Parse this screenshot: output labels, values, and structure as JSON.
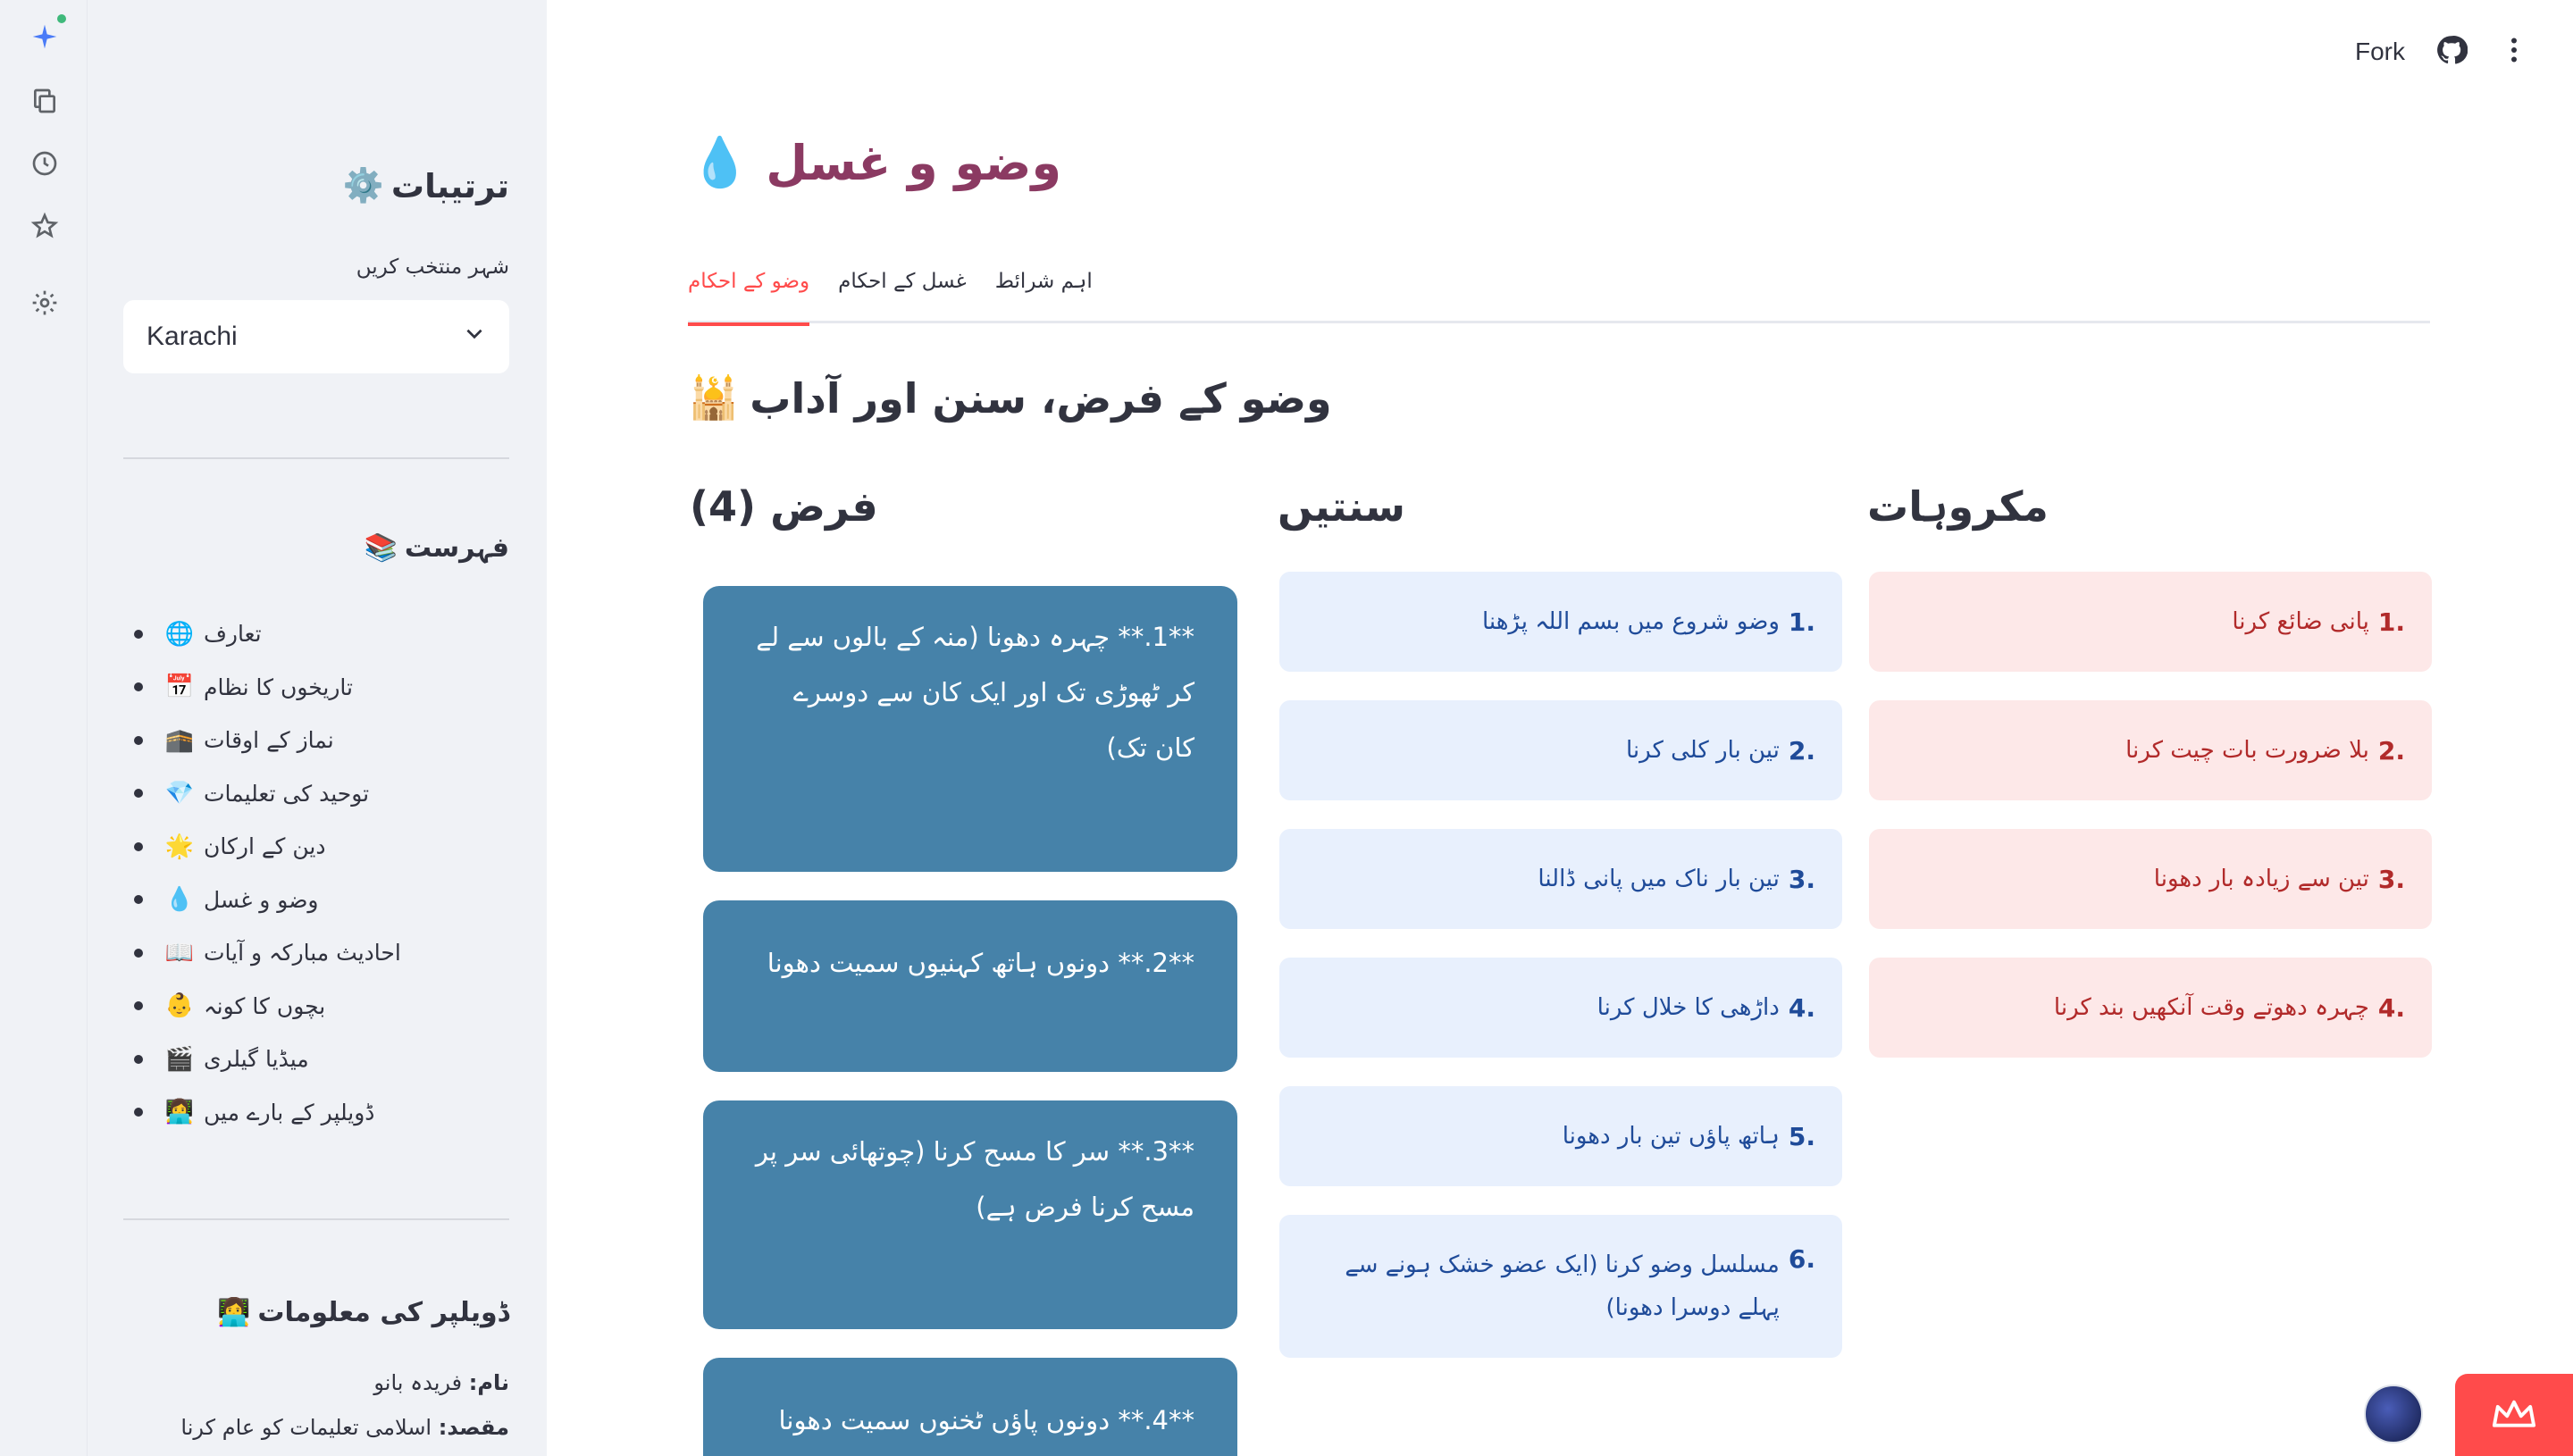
{
  "header": {
    "fork_label": "Fork"
  },
  "sidebar": {
    "settings_title": "ترتیبات",
    "settings_icon": "⚙️",
    "city_label": "شہر منتخب کریں",
    "city_value": "Karachi",
    "toc_title": "فہرست",
    "toc_icon": "📚",
    "toc": [
      {
        "label": "تعارف",
        "emoji": "🌐"
      },
      {
        "label": "تاریخوں کا نظام",
        "emoji": "📅"
      },
      {
        "label": "نماز کے اوقات",
        "emoji": "🕋"
      },
      {
        "label": "توحید کی تعلیمات",
        "emoji": "💎"
      },
      {
        "label": "دین کے ارکان",
        "emoji": "🌟"
      },
      {
        "label": "وضو و غسل",
        "emoji": "💧"
      },
      {
        "label": "احادیث مبارکہ و آیات",
        "emoji": "📖"
      },
      {
        "label": "بچوں کا کونہ",
        "emoji": "👶"
      },
      {
        "label": "میڈیا گیلری",
        "emoji": "🎬"
      },
      {
        "label": "ڈویلپر کے بارے میں",
        "emoji": "👩‍💻"
      }
    ],
    "dev_title": "ڈویلپر کی معلومات",
    "dev_icon": "👩‍💻",
    "dev_name_key": "نام:",
    "dev_name_value": "فریدہ بانو",
    "dev_purpose_key": "مقصد:",
    "dev_purpose_value": "اسلامی تعلیمات کو عام کرنا"
  },
  "main": {
    "title": "وضو و غسل",
    "title_icon": "💧",
    "tabs": [
      {
        "label": "وضو کے احکام",
        "active": true
      },
      {
        "label": "غسل کے احکام",
        "active": false
      },
      {
        "label": "اہم شرائط",
        "active": false
      }
    ],
    "section_title": "وضو کے فرض، سنن اور آداب",
    "section_icon": "🕌",
    "fard_title": "فرض (4)",
    "sunnah_title": "سنتیں",
    "makruh_title": "مکروہات",
    "fard": [
      "**1.** چہرہ دھونا (منہ کے بالوں سے لے کر ٹھوڑی تک اور ایک کان سے دوسرے کان تک)",
      "**2.** دونوں ہاتھ کہنیوں سمیت دھونا",
      "**3.** سر کا مسح کرنا (چوتھائی سر پر مسح کرنا فرض ہے)",
      "**4.** دونوں پاؤں ٹخنوں سمیت دھونا"
    ],
    "sunnah": [
      {
        "num": "1.",
        "text": "وضو شروع میں بسم اللہ پڑھنا"
      },
      {
        "num": "2.",
        "text": "تین بار کلی کرنا"
      },
      {
        "num": "3.",
        "text": "تین بار ناک میں پانی ڈالنا"
      },
      {
        "num": "4.",
        "text": "داڑھی کا خلال کرنا"
      },
      {
        "num": "5.",
        "text": "ہاتھ پاؤں تین بار دھونا"
      },
      {
        "num": "6.",
        "text": "مسلسل وضو کرنا (ایک عضو خشک ہونے سے پہلے دوسرا دھونا)"
      }
    ],
    "makruh": [
      {
        "num": "1.",
        "text": "پانی ضائع کرنا"
      },
      {
        "num": "2.",
        "text": "بلا ضرورت بات چیت کرنا"
      },
      {
        "num": "3.",
        "text": "تین سے زیادہ بار دھونا"
      },
      {
        "num": "4.",
        "text": "چہرہ دھوتے وقت آنکھیں بند کرنا"
      }
    ]
  },
  "colors": {
    "accent": "#ff4b4b",
    "title": "#8b3a62",
    "fard_card": "#4682a9",
    "sunnah_card": "#e8f0fd",
    "makruh_card": "#fde8e8"
  }
}
